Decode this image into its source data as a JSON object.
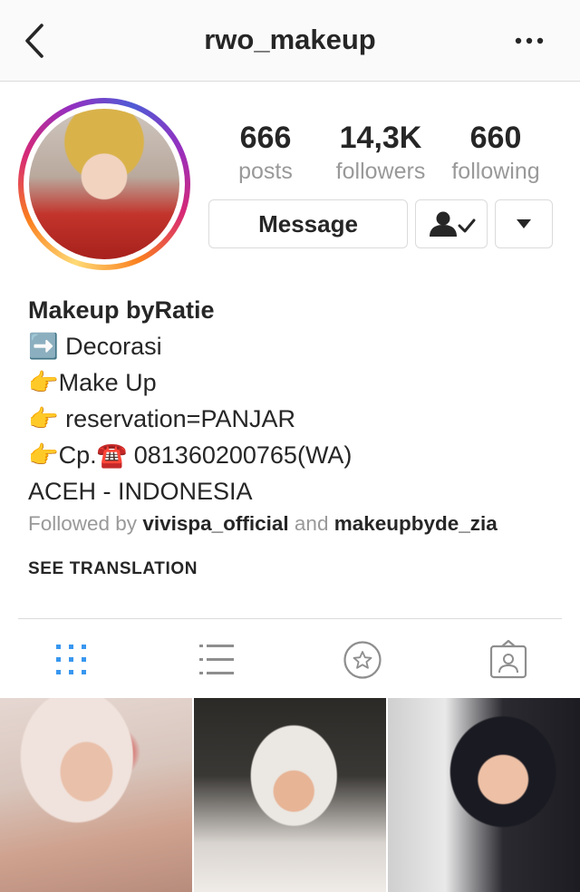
{
  "header": {
    "title": "rwo_makeup",
    "back_icon": "chevron-left-icon",
    "more_icon": "more-horizontal-icon"
  },
  "profile": {
    "avatar_ring_colors": [
      "#feda75",
      "#fa7e1e",
      "#d62976",
      "#962fbf",
      "#4f5bd5"
    ],
    "stats": [
      {
        "value": "666",
        "label": "posts"
      },
      {
        "value": "14,3K",
        "label": "followers"
      },
      {
        "value": "660",
        "label": "following"
      }
    ],
    "actions": {
      "message_label": "Message",
      "following_icon": "person-check-icon",
      "dropdown_icon": "caret-down-icon"
    }
  },
  "bio": {
    "name": "Makeup byRatie",
    "lines": [
      "➡️ Decorasi",
      "👉Make Up",
      "👉 reservation=PANJAR",
      "👉Cp.☎️ 081360200765(WA)",
      "ACEH - INDONESIA"
    ],
    "followed_prefix": "Followed by",
    "followed_user_1": "vivispa_official",
    "followed_and": "and",
    "followed_user_2": "makeupbyde_zia",
    "see_translation": "SEE TRANSLATION"
  },
  "tabs": [
    {
      "icon": "grid-icon",
      "active": true,
      "color": "#3897f0"
    },
    {
      "icon": "list-icon",
      "active": false
    },
    {
      "icon": "star-circle-icon",
      "active": false
    },
    {
      "icon": "tagged-person-icon",
      "active": false
    }
  ],
  "grid": [
    {
      "kind": "photo"
    },
    {
      "kind": "photo"
    },
    {
      "kind": "photo"
    }
  ]
}
